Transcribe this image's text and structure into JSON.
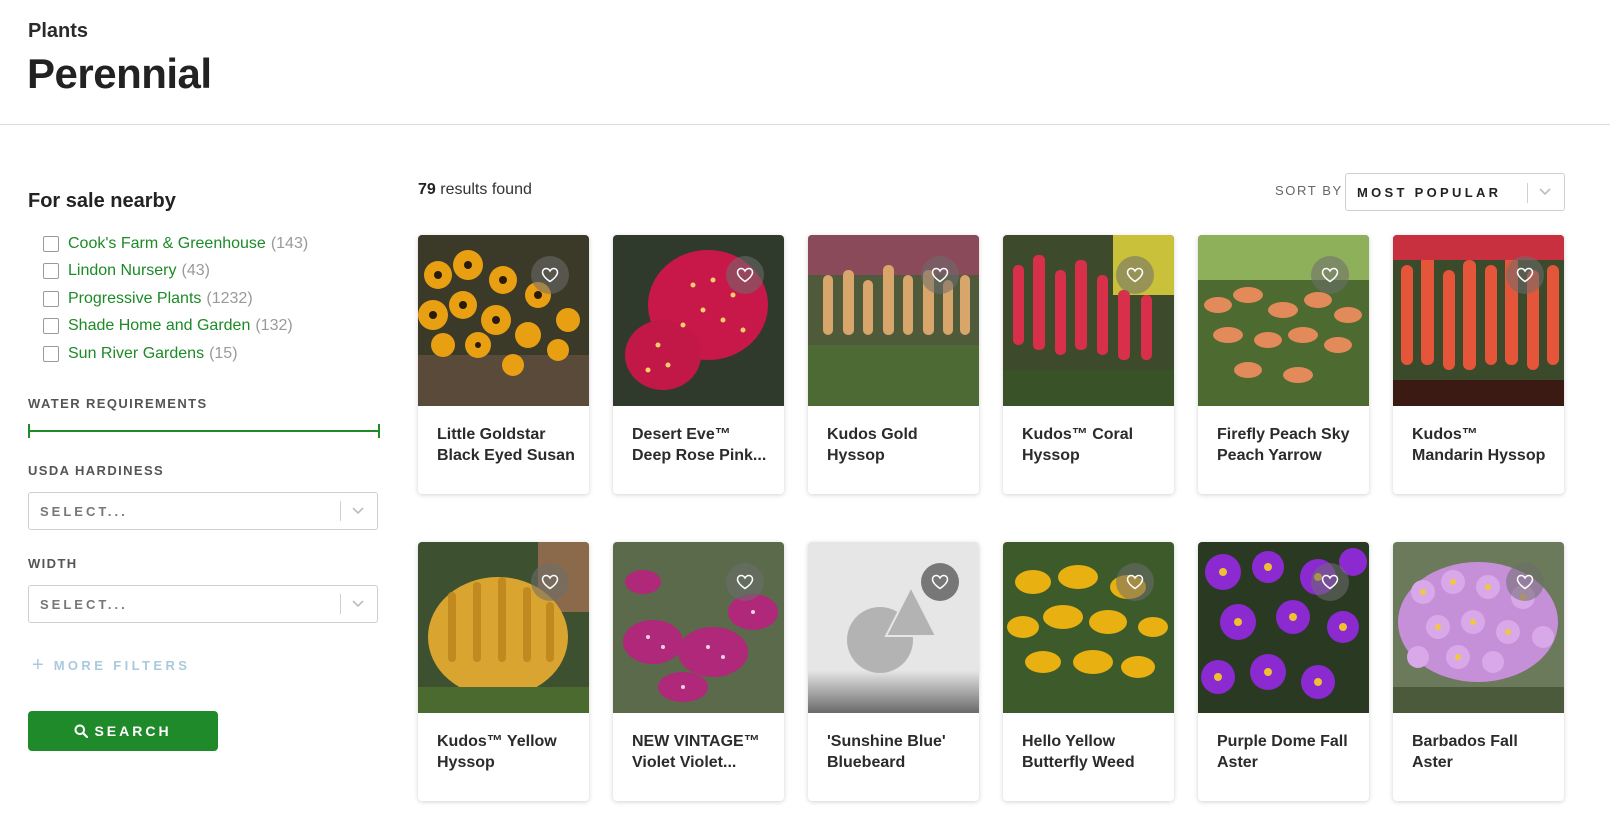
{
  "header": {
    "breadcrumb": "Plants",
    "title": "Perennial"
  },
  "sidebar": {
    "nearby_title": "For sale nearby",
    "stores": [
      {
        "name": "Cook's Farm & Greenhouse",
        "count": "(143)"
      },
      {
        "name": "Lindon Nursery",
        "count": "(43)"
      },
      {
        "name": "Progressive Plants",
        "count": "(1232)"
      },
      {
        "name": "Shade Home and Garden",
        "count": "(132)"
      },
      {
        "name": "Sun River Gardens",
        "count": "(15)"
      }
    ],
    "water_label": "WATER REQUIREMENTS",
    "usda_label": "USDA HARDINESS",
    "usda_placeholder": "SELECT...",
    "width_label": "WIDTH",
    "width_placeholder": "SELECT...",
    "more_filters_label": "MORE FILTERS",
    "search_label": "SEARCH"
  },
  "results": {
    "count": "79",
    "suffix": "results found"
  },
  "sort": {
    "label": "SORT BY",
    "value": "MOST POPULAR"
  },
  "products": [
    {
      "name": "Little Goldstar Black Eyed Susan",
      "icon": "rudbeckia-yellow"
    },
    {
      "name": "Desert Eve™ Deep Rose Pink...",
      "icon": "yarrow-rose"
    },
    {
      "name": "Kudos Gold Hyssop",
      "icon": "hyssop-gold"
    },
    {
      "name": "Kudos™ Coral Hyssop",
      "icon": "hyssop-coral"
    },
    {
      "name": "Firefly Peach Sky Peach Yarrow",
      "icon": "yarrow-peach"
    },
    {
      "name": "Kudos™ Mandarin Hyssop",
      "icon": "hyssop-mandarin"
    },
    {
      "name": "Kudos™ Yellow Hyssop",
      "icon": "hyssop-yellow"
    },
    {
      "name": "NEW VINTAGE™ Violet Violet...",
      "icon": "yarrow-violet"
    },
    {
      "name": "'Sunshine Blue' Bluebeard",
      "icon": "placeholder-image"
    },
    {
      "name": "Hello Yellow Butterfly Weed",
      "icon": "butterfly-weed-yellow"
    },
    {
      "name": "Purple Dome Fall Aster",
      "icon": "aster-purple"
    },
    {
      "name": "Barbados Fall Aster",
      "icon": "aster-pink"
    }
  ],
  "colors": {
    "accent_green": "#1f8a2a",
    "link_green": "#1c8a26",
    "muted_blue": "#a9c9dc"
  }
}
